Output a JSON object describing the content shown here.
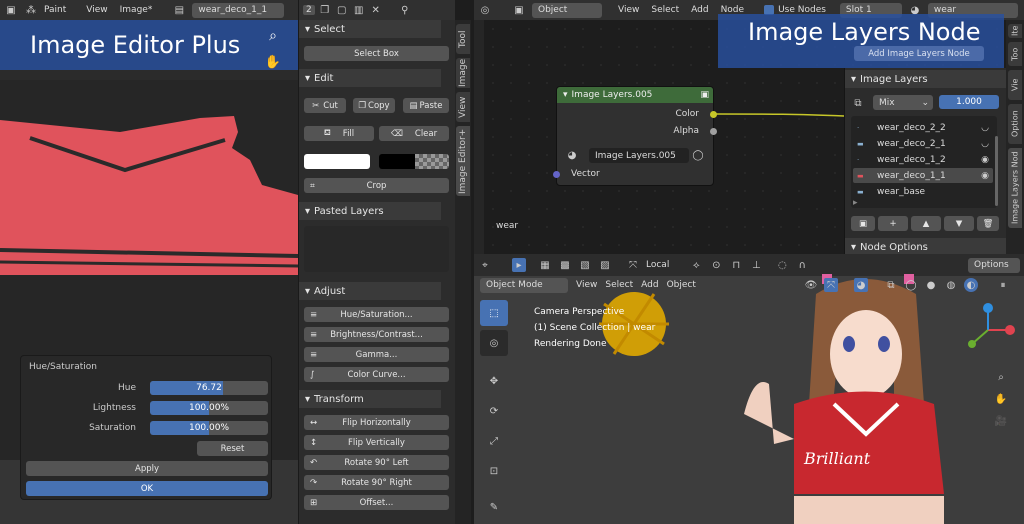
{
  "image_editor": {
    "banner": "Image Editor Plus",
    "header_menus": [
      "Paint",
      "View",
      "Image*"
    ],
    "image_name": "wear_deco_1_1",
    "header_count": "2"
  },
  "sidebar": {
    "tabs": [
      "Tool",
      "Image",
      "View",
      "Image Editor+"
    ],
    "select_header": "Select",
    "select_box": "Select Box",
    "edit_header": "Edit",
    "cut": "Cut",
    "copy": "Copy",
    "paste": "Paste",
    "fill": "Fill",
    "clear": "Clear",
    "crop": "Crop",
    "pasted_layers_header": "Pasted Layers",
    "adjust_header": "Adjust",
    "adjust_items": [
      "Hue/Saturation...",
      "Brightness/Contrast...",
      "Gamma...",
      "Color Curve..."
    ],
    "transform_header": "Transform",
    "transform_items": [
      "Flip Horizontally",
      "Flip Vertically",
      "Rotate 90° Left",
      "Rotate 90° Right",
      "Offset..."
    ]
  },
  "hue_dialog": {
    "title": "Hue/Saturation",
    "hue_label": "Hue",
    "hue_value": "76.72",
    "hue_fraction": 0.62,
    "lightness_label": "Lightness",
    "lightness_value": "100.00%",
    "saturation_label": "Saturation",
    "saturation_value": "100.00%",
    "reset": "Reset",
    "apply": "Apply",
    "ok": "OK"
  },
  "node_editor": {
    "banner": "Image Layers Node",
    "menus": [
      "Object",
      "View",
      "Select",
      "Add",
      "Node"
    ],
    "use_nodes": "Use Nodes",
    "slot": "Slot 1",
    "material": "wear",
    "add_image_layers": "Add Image Layers Node",
    "material_label": "wear",
    "node": {
      "title": "Image Layers.005",
      "out_color": "Color",
      "out_alpha": "Alpha",
      "datablock": "Image Layers.005",
      "in_vector": "Vector"
    },
    "panel": {
      "header": "Image Layers",
      "blend": "Mix",
      "factor": "1.000",
      "layers": [
        "wear_deco_2_2",
        "wear_deco_2_1",
        "wear_deco_1_2",
        "wear_deco_1_1",
        "wear_base"
      ],
      "node_options": "Node Options"
    },
    "tabs": [
      "Ite",
      "Too",
      "Vie",
      "Option",
      "Image Layers Nod"
    ]
  },
  "viewport": {
    "mode": "Object Mode",
    "menus": [
      "View",
      "Select",
      "Add",
      "Object"
    ],
    "transform_orientation": "Local",
    "options": "Options",
    "info_lines": [
      "Camera Perspective",
      "(1) Scene Collection | wear",
      "Rendering Done"
    ],
    "shirt_text": "Brilliant"
  },
  "colors": {
    "accent": "#4772b3",
    "banner": "#2850a0",
    "canvas_red": "#e0535c",
    "node_green": "#3e6b3a"
  }
}
